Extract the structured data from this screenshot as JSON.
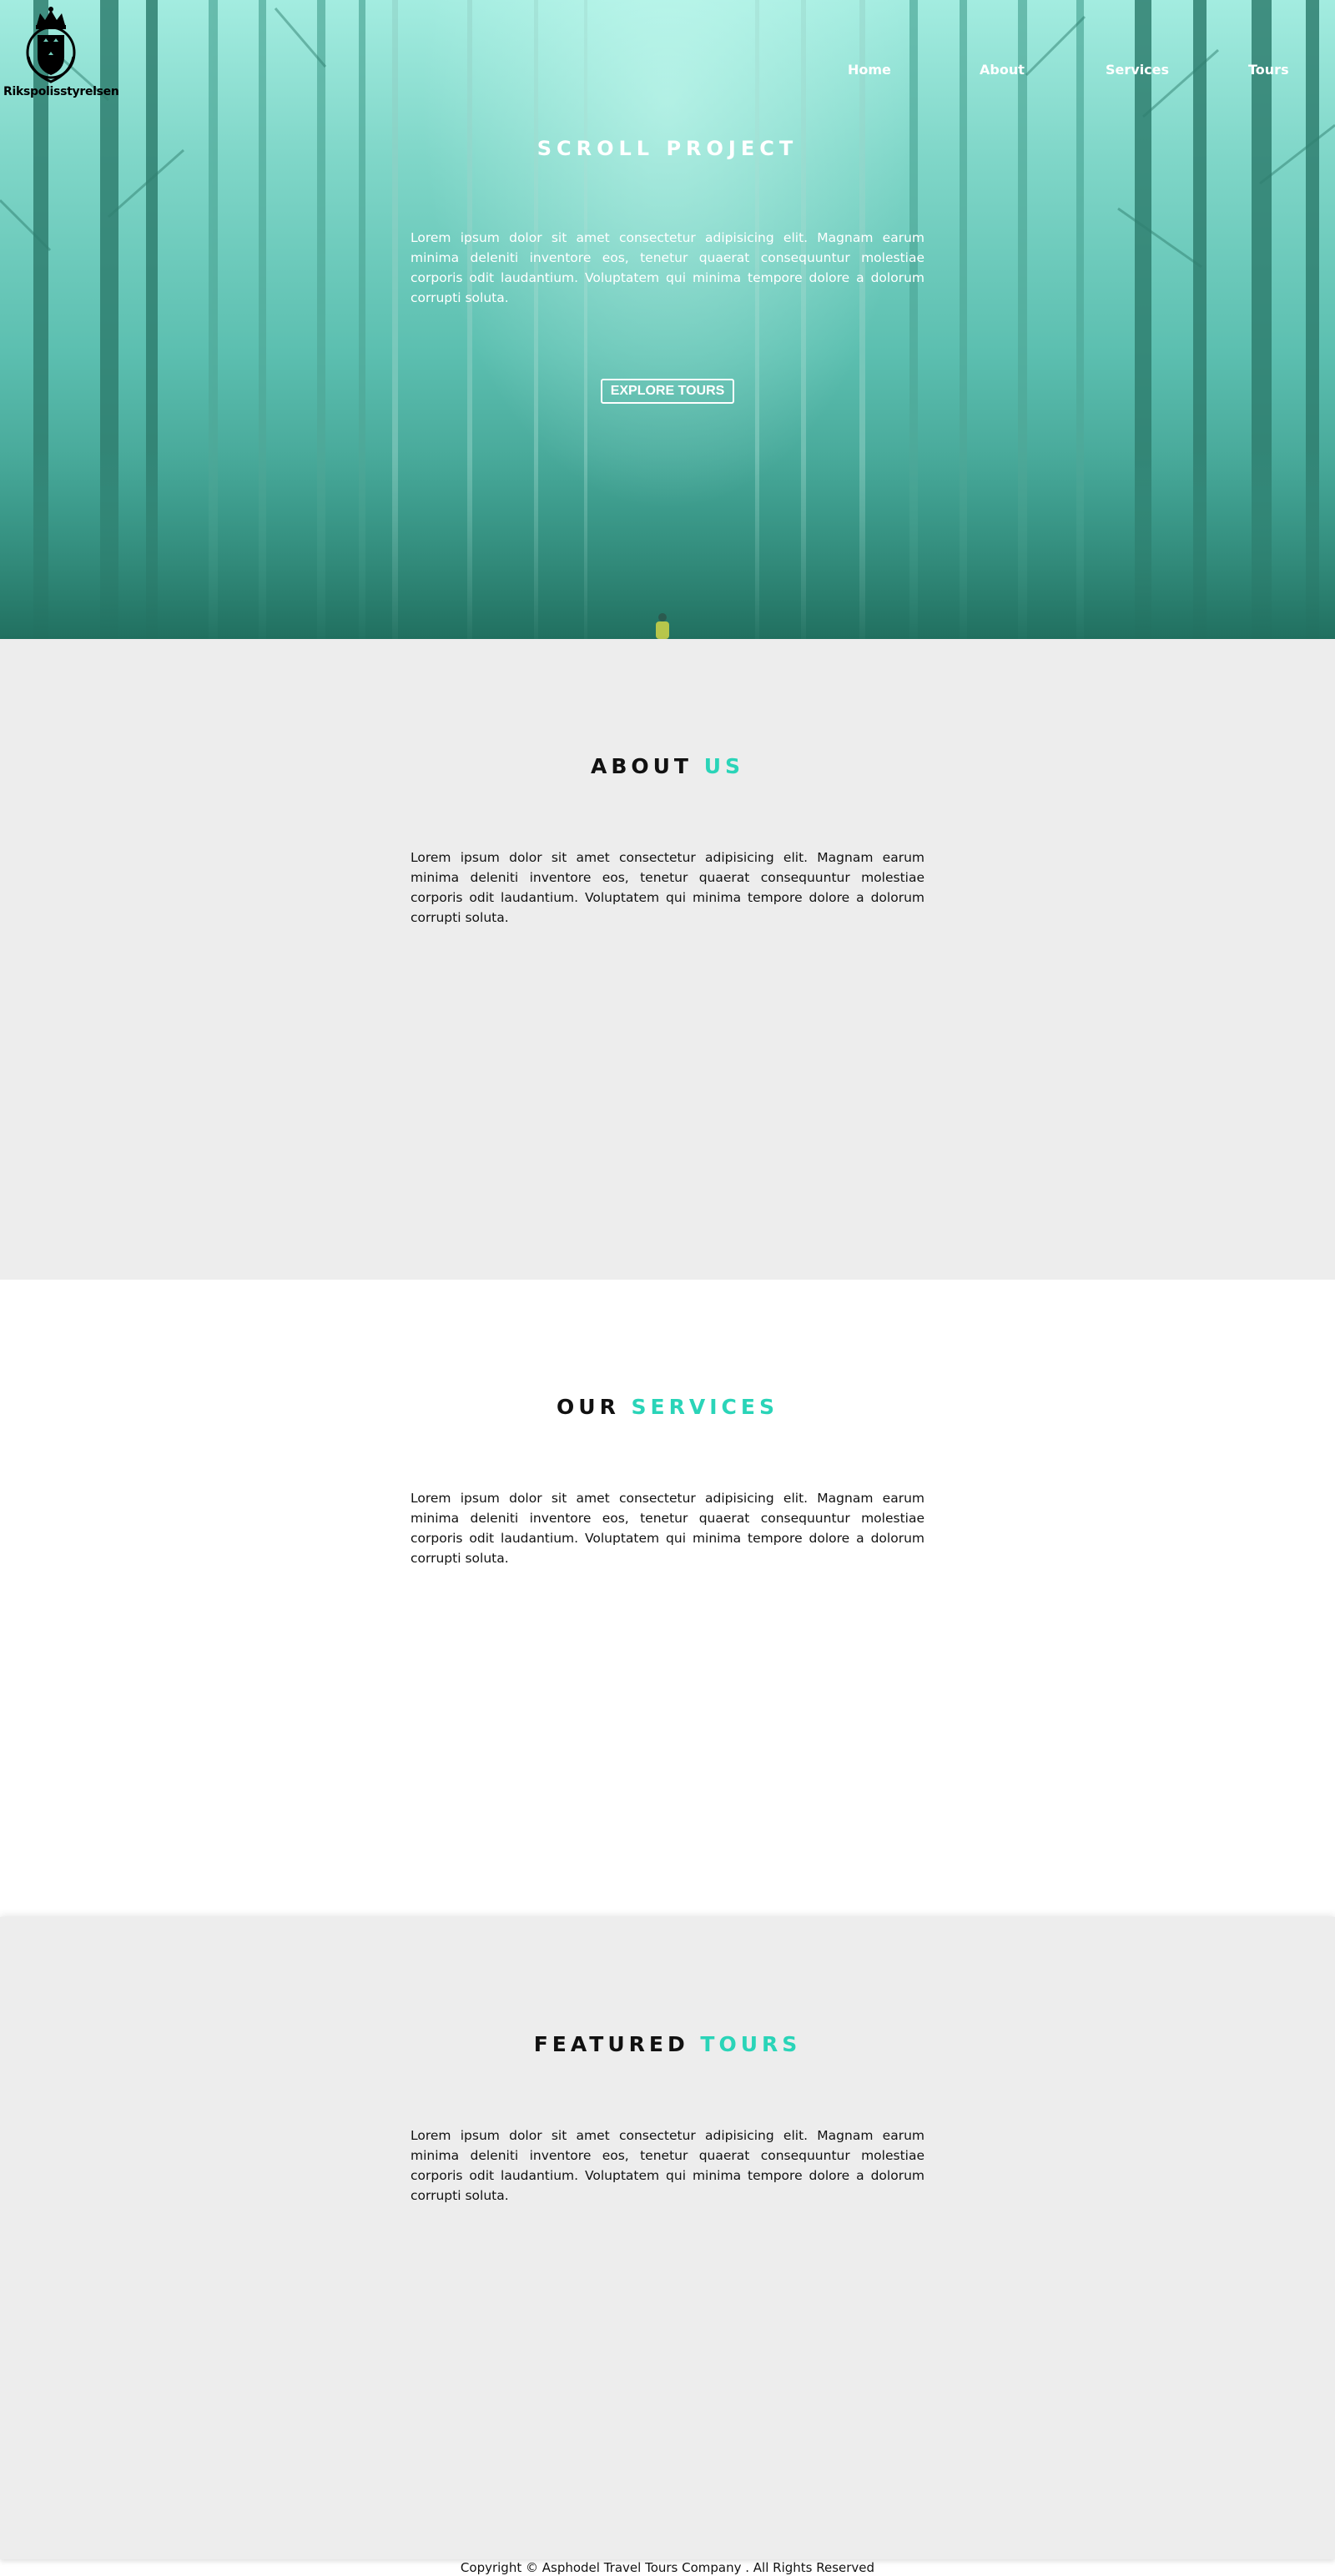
{
  "brand": {
    "name": "Rikspolisstyrelsen",
    "logo_icon": "crowned-shield-emblem-icon"
  },
  "nav": {
    "items": [
      {
        "label": "Home"
      },
      {
        "label": "About"
      },
      {
        "label": "Services"
      },
      {
        "label": "Tours"
      }
    ]
  },
  "hero": {
    "title": "SCROLL PROJECT",
    "text": "Lorem ipsum dolor sit amet consectetur adipisicing elit. Magnam earum minima deleniti inventore eos, tenetur quaerat consequuntur molestiae corporis odit laudantium. Voluptatem qui minima tempore dolore a dolorum corrupti soluta.",
    "button_label": "EXPLORE TOURS",
    "background": "misty-forest-photo"
  },
  "sections": {
    "about": {
      "title_main": "ABOUT",
      "title_accent": "US",
      "text": "Lorem ipsum dolor sit amet consectetur adipisicing elit. Magnam earum minima deleniti inventore eos, tenetur quaerat consequuntur molestiae corporis odit laudantium. Voluptatem qui minima tempore dolore a dolorum corrupti soluta."
    },
    "services": {
      "title_main": "OUR",
      "title_accent": "SERVICES",
      "text": "Lorem ipsum dolor sit amet consectetur adipisicing elit. Magnam earum minima deleniti inventore eos, tenetur quaerat consequuntur molestiae corporis odit laudantium. Voluptatem qui minima tempore dolore a dolorum corrupti soluta."
    },
    "tours": {
      "title_main": "FEATURED",
      "title_accent": "TOURS",
      "text": "Lorem ipsum dolor sit amet consectetur adipisicing elit. Magnam earum minima deleniti inventore eos, tenetur quaerat consequuntur molestiae corporis odit laudantium. Voluptatem qui minima tempore dolore a dolorum corrupti soluta."
    }
  },
  "footer": {
    "text": "Copyright © Asphodel Travel Tours Company . All Rights Reserved"
  },
  "colors": {
    "accent": "#2ad4b8",
    "section_gray": "#ededed",
    "hero_tint": "#5cbfb0"
  }
}
